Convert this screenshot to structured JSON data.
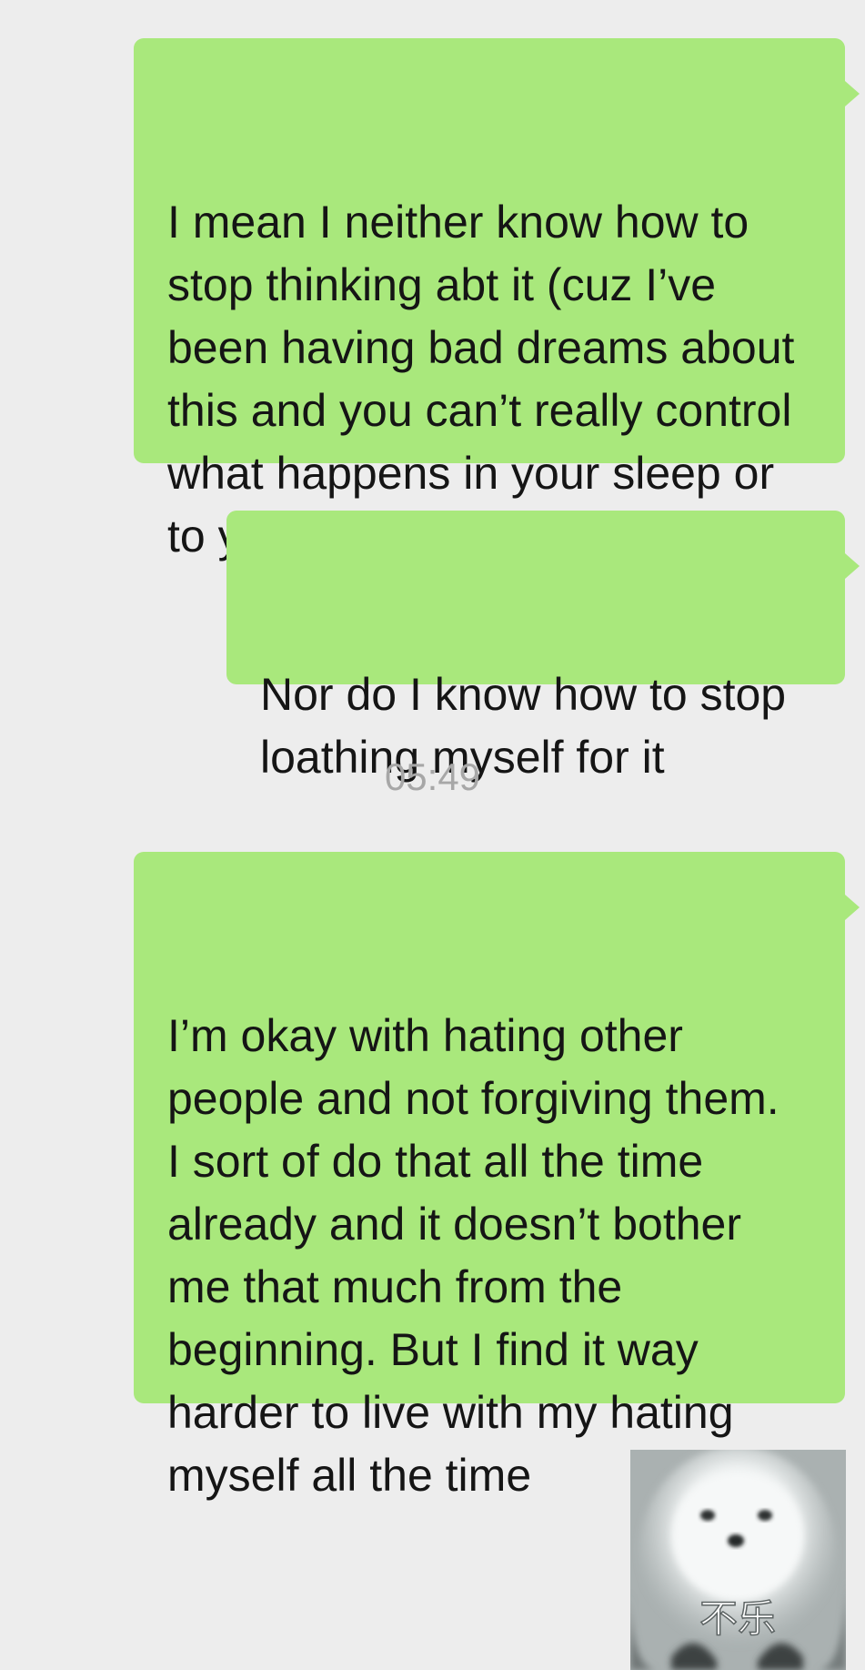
{
  "chat": {
    "messages": [
      {
        "sender": "self",
        "type": "text",
        "text": "I mean I neither know how to\nstop thinking abt it (cuz I’ve\nbeen having bad dreams about\nthis and you can’t really control\nwhat happens in your sleep or\nto your sleep…)"
      },
      {
        "sender": "self",
        "type": "text",
        "text": "Nor do I know how to stop\nloathing myself for it"
      },
      {
        "type": "timestamp",
        "text": "05:49"
      },
      {
        "sender": "self",
        "type": "text",
        "text": "I’m okay with hating other\npeople and not forgiving them.\nI sort of do that all the time\nalready and it doesn’t bother\nme that much from the\nbeginning. But I find it way\nharder to live with my hating\nmyself all the time"
      },
      {
        "sender": "self",
        "type": "sticker",
        "sticker_icon": "white-dog-sticker-icon",
        "caption": "不乐"
      }
    ]
  },
  "colors": {
    "background": "#ededed",
    "bubble": "#a9e87c",
    "text": "#151515",
    "timestamp": "#a7a7a7"
  }
}
